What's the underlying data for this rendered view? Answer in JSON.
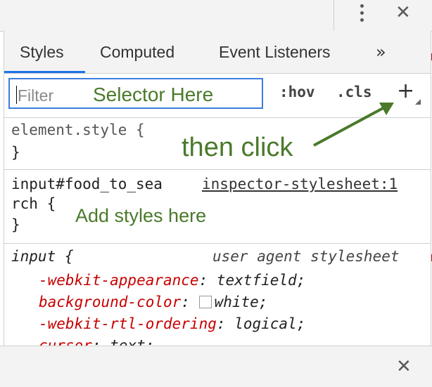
{
  "tabs": [
    {
      "label": "Styles",
      "active": true
    },
    {
      "label": "Computed",
      "active": false
    },
    {
      "label": "Event Listeners",
      "active": false
    }
  ],
  "more_tabs_label": "»",
  "filter": {
    "placeholder": "Filter"
  },
  "toolbar": {
    "hov_label": ":hov",
    "cls_label": ".cls",
    "add_rule_label": "+"
  },
  "annotations": {
    "selector_here": "Selector Here",
    "then_click": "then click",
    "add_styles_here": "Add styles here",
    "color": "#4a7a2a"
  },
  "rules": {
    "element_style": {
      "selector": "element.style {",
      "close": "}"
    },
    "custom": {
      "selector_line1": "input#food_to_sea",
      "selector_line2": "rch {",
      "source": "inspector-stylesheet:1",
      "close": "}"
    },
    "user_agent": {
      "selector": "input {",
      "source": "user agent stylesheet",
      "declarations": [
        {
          "prop": "-webkit-appearance",
          "value": "textfield;"
        },
        {
          "prop": "background-color",
          "value": "white;",
          "swatch": "#ffffff"
        },
        {
          "prop": "-webkit-rtl-ordering",
          "value": "logical;"
        },
        {
          "prop": "cursor",
          "value": "text;"
        }
      ]
    }
  },
  "icons": {
    "kebab": "kebab-menu-icon",
    "close": "close-icon",
    "plus": "plus-icon"
  },
  "colors": {
    "accent": "#1a73e8",
    "property_red": "#c80000"
  }
}
